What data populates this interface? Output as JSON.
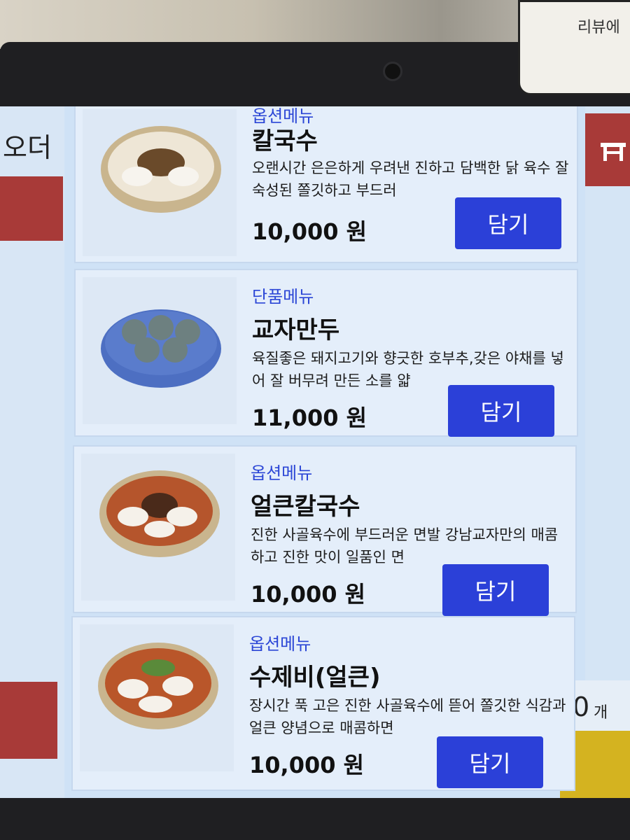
{
  "review_card": {
    "text": "리뷰에"
  },
  "sidebar": {
    "order_label": "오더"
  },
  "cart": {
    "count": "0",
    "unit": "개"
  },
  "colors": {
    "accent_blue": "#2b40d8",
    "category_blue": "#2b46d6",
    "rail_red": "#a83a38",
    "rail_yellow": "#d4b320"
  },
  "menu": {
    "items": [
      {
        "category": "옵션메뉴",
        "name": "칼국수",
        "description": "오랜시간 은은하게 우려낸 진하고 담백한 닭 육수 잘 숙성된 쫄깃하고 부드러",
        "price": "10,000 원",
        "add_label": "담기",
        "image": "bowl-of-kalguksu"
      },
      {
        "category": "단품메뉴",
        "name": "교자만두",
        "description": "육질좋은 돼지고기와 향긋한 호부추,갖은 야채를 넣어 잘 버무려 만든 소를 얇",
        "price": "11,000 원",
        "add_label": "담기",
        "image": "plate-of-dumplings"
      },
      {
        "category": "옵션메뉴",
        "name": "얼큰칼국수",
        "description": "진한 사골육수에 부드러운 면발 강남교자만의 매콤하고 진한 맛이 일품인 면",
        "price": "10,000 원",
        "add_label": "담기",
        "image": "bowl-of-spicy-kalguksu"
      },
      {
        "category": "옵션메뉴",
        "name": "수제비(얼큰)",
        "description": "장시간 푹 고은 진한 사골육수에 뜯어 쫄깃한 식감과 얼큰 양념으로 매콤하면",
        "price": "10,000 원",
        "add_label": "담기",
        "image": "bowl-of-spicy-sujebi"
      }
    ]
  }
}
